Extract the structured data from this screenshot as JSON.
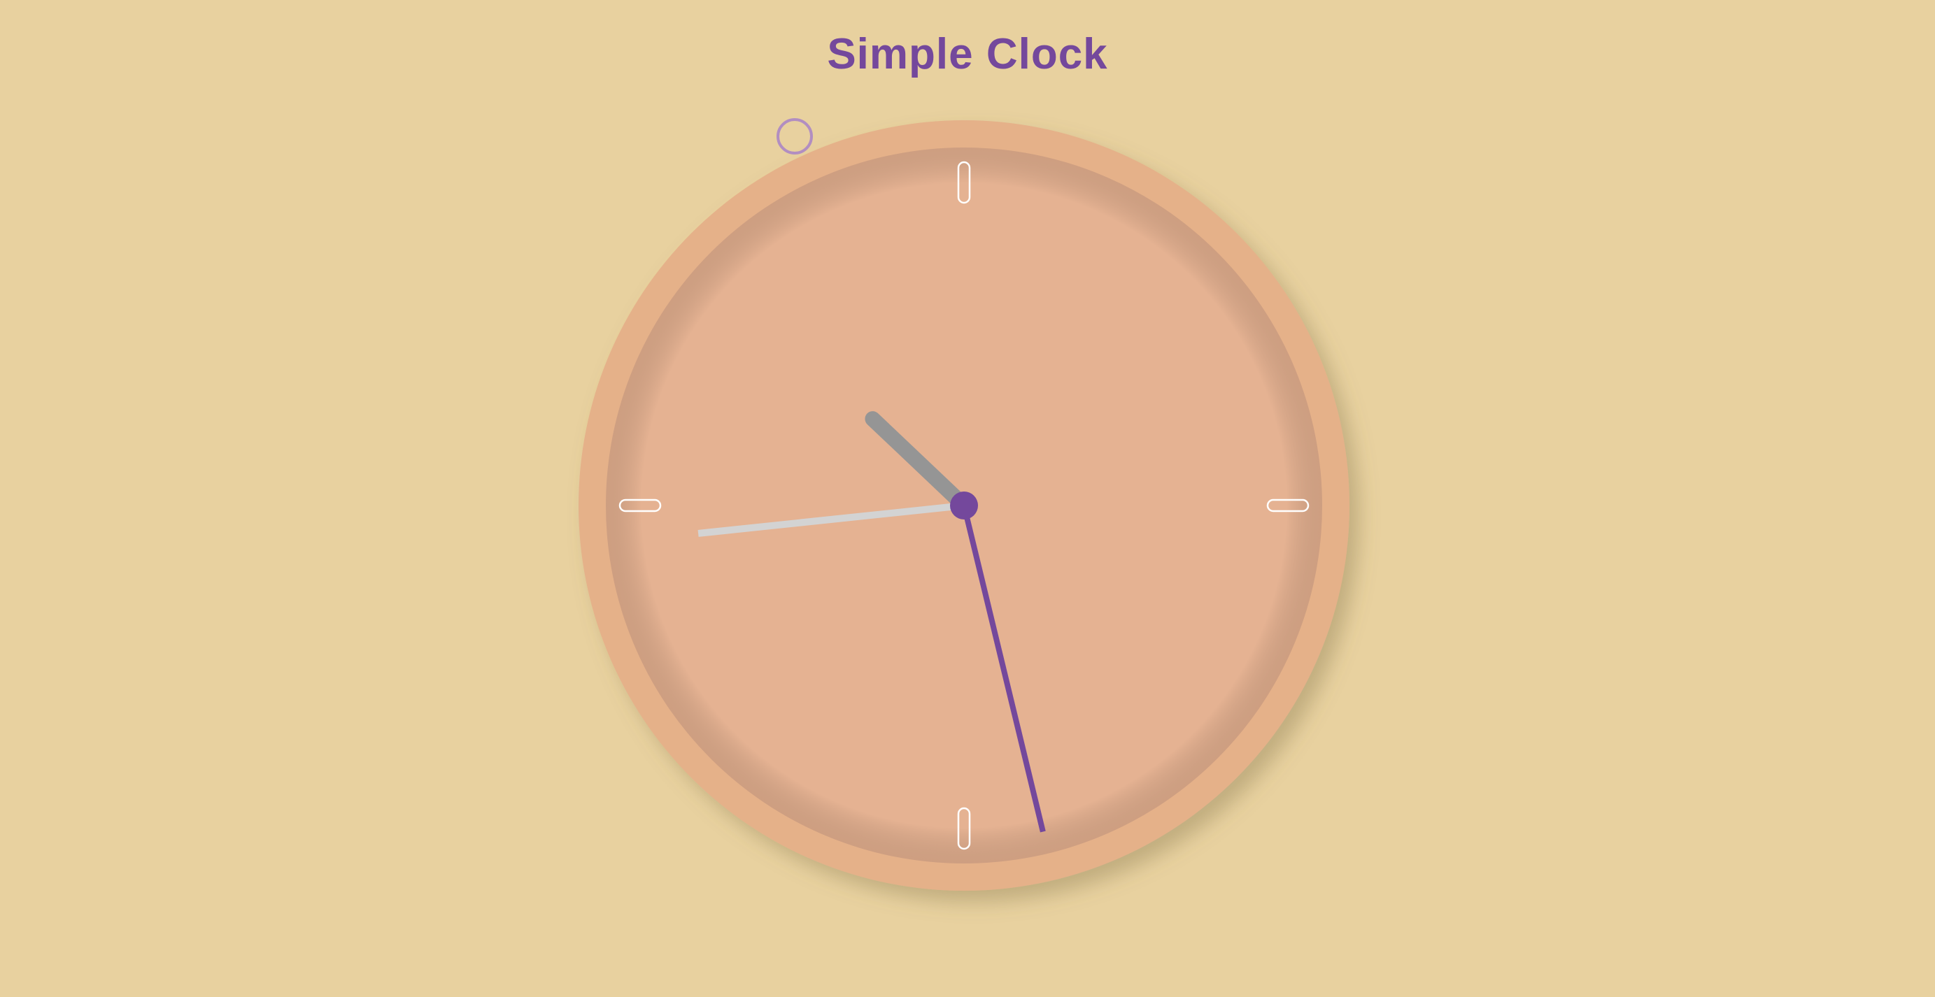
{
  "page": {
    "title": "Simple Clock"
  },
  "clock": {
    "time": {
      "hours": 10,
      "minutes": 27,
      "seconds": 44
    },
    "colors": {
      "background": "#e8d19f",
      "bezel": "#e5b189",
      "face": "#e5b292",
      "hour_hand": "#959595",
      "minute_hand": "#74489c",
      "second_hand": "#d3d3d3",
      "center_cap": "#74489c",
      "marker": "#ffffff"
    },
    "markers": [
      "12",
      "3",
      "6",
      "9"
    ]
  },
  "icons": {
    "cursor": "cursor-ring-icon"
  }
}
